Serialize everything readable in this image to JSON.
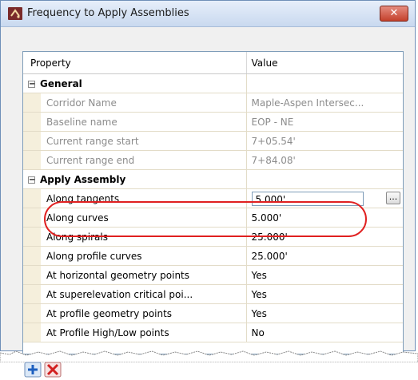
{
  "window": {
    "title": "Frequency to Apply Assemblies",
    "close_label": "✕"
  },
  "grid": {
    "headers": {
      "property": "Property",
      "value": "Value"
    },
    "categories": [
      {
        "label": "General",
        "expander": "−",
        "rows": [
          {
            "name": "Corridor Name",
            "value": "Maple-Aspen Intersec..."
          },
          {
            "name": "Baseline name",
            "value": "EOP - NE"
          },
          {
            "name": "Current range start",
            "value": "7+05.54'"
          },
          {
            "name": "Current range end",
            "value": "7+84.08'"
          }
        ]
      },
      {
        "label": "Apply Assembly",
        "expander": "−",
        "rows": [
          {
            "name": "Along tangents",
            "value": "5.000'"
          },
          {
            "name": "Along curves",
            "value": "5.000'"
          },
          {
            "name": "Along spirals",
            "value": "25.000'"
          },
          {
            "name": "Along profile curves",
            "value": "25.000'"
          },
          {
            "name": "At horizontal geometry points",
            "value": "Yes"
          },
          {
            "name": "At superelevation critical poi...",
            "value": "Yes"
          },
          {
            "name": "At profile geometry points",
            "value": "Yes"
          },
          {
            "name": "At Profile High/Low points",
            "value": "No"
          }
        ]
      }
    ],
    "ellipsis_label": "..."
  },
  "colors": {
    "highlight": "#e02020",
    "close_button": "#c4412c",
    "title_bar": "#c9d9ef"
  },
  "icons": {
    "app": "civil3d-icon",
    "add": "add-icon",
    "delete": "delete-icon"
  }
}
